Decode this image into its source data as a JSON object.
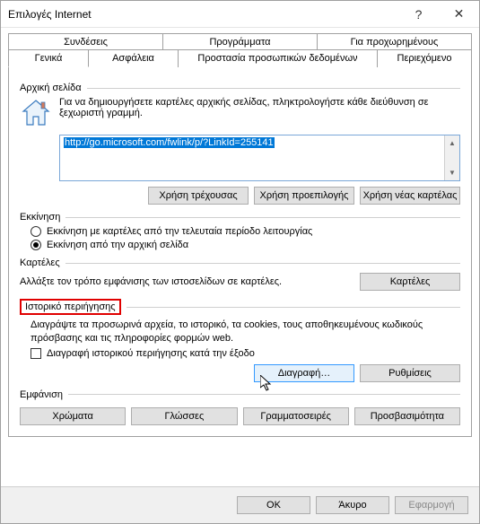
{
  "titlebar": {
    "title": "Επιλογές Internet"
  },
  "tabs": {
    "row1": [
      "Συνδέσεις",
      "Προγράμματα",
      "Για προχωρημένους"
    ],
    "row2": [
      "Γενικά",
      "Ασφάλεια",
      "Προστασία προσωπικών δεδομένων",
      "Περιεχόμενο"
    ],
    "active": "Γενικά"
  },
  "home": {
    "group_label": "Αρχική σελίδα",
    "instruction": "Για να δημιουργήσετε καρτέλες αρχικής σελίδας, πληκτρολογήστε κάθε διεύθυνση σε ξεχωριστή γραμμή.",
    "url": "http://go.microsoft.com/fwlink/p/?LinkId=255141",
    "buttons": {
      "current": "Χρήση τρέχουσας",
      "default": "Χρήση προεπιλογής",
      "newtab": "Χρήση νέας καρτέλας"
    }
  },
  "startup": {
    "group_label": "Εκκίνηση",
    "opt1": "Εκκίνηση με καρτέλες από την τελευταία περίοδο λειτουργίας",
    "opt2": "Εκκίνηση από την αρχική σελίδα",
    "selected": 2
  },
  "tabs_section": {
    "group_label": "Καρτέλες",
    "desc": "Αλλάξτε τον τρόπο εμφάνισης των ιστοσελίδων σε καρτέλες.",
    "button": "Καρτέλες"
  },
  "history": {
    "group_label": "Ιστορικό περιήγησης",
    "desc": "Διαγράψτε τα προσωρινά αρχεία, το ιστορικό, τα cookies, τους αποθηκευμένους κωδικούς πρόσβασης και τις πληροφορίες φορμών web.",
    "check_label": "Διαγραφή ιστορικού περιήγησης κατά την έξοδο",
    "delete_btn": "Διαγραφή…",
    "settings_btn": "Ρυθμίσεις"
  },
  "appearance": {
    "group_label": "Εμφάνιση",
    "buttons": {
      "colors": "Χρώματα",
      "languages": "Γλώσσες",
      "fonts": "Γραμματοσειρές",
      "accessibility": "Προσβασιμότητα"
    }
  },
  "footer": {
    "ok": "OK",
    "cancel": "Άκυρο",
    "apply": "Εφαρμογή"
  }
}
